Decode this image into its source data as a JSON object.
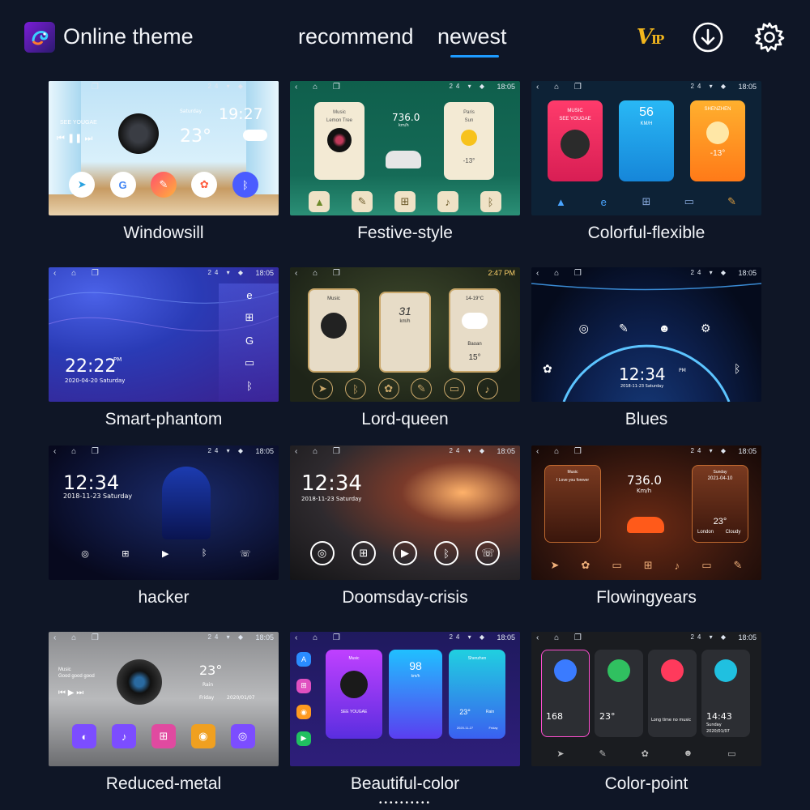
{
  "header": {
    "app_title": "Online theme",
    "tabs": [
      {
        "label": "recommend",
        "selected": false
      },
      {
        "label": "newest",
        "selected": true
      }
    ],
    "vip_label": "V",
    "vip_suffix": "IP",
    "accent_color": "#1e9bff"
  },
  "status_bar": {
    "time": "18:05",
    "nav": "‹ ⌂ ❐",
    "signal": "24 ▾ ◆"
  },
  "themes": [
    {
      "name": "Windowsill",
      "clock": "19:27",
      "date": "Saturday",
      "temp": "23°",
      "music": "SEE YOUGAE"
    },
    {
      "name": "Festive-style",
      "music": "Music",
      "song": "Lemon Tree",
      "speed": "736.0",
      "unit": "km/h",
      "city": "Paris",
      "weather": "Sun",
      "temp": "-13°"
    },
    {
      "name": "Colorful-flexible",
      "music": "MUSIC",
      "artist": "SEE YOUGAE",
      "speed": "56",
      "unit": "KM/H",
      "city": "SHENZHEN",
      "temp": "-13°",
      "apps": [
        "map",
        "explorer",
        "apps",
        "radio",
        "theme"
      ]
    },
    {
      "name": "Smart-phantom",
      "clock": "22:22",
      "ampm": "PM",
      "date": "2020-04-20 Saturday",
      "apps": [
        "explorer",
        "apps",
        "google",
        "radio",
        "bt"
      ]
    },
    {
      "name": "Lord-queen",
      "music": "Music",
      "speed": "31",
      "unit": "km/h",
      "weather": "14-19°C",
      "city": "Baoan",
      "temp": "15°",
      "clock": "2:47 PM"
    },
    {
      "name": "Blues",
      "clock": "12:34",
      "ampm": "PM",
      "date": "2018-11-23 Saturday",
      "apps": [
        "explorer",
        "theme",
        "easteared",
        "setting"
      ]
    },
    {
      "name": "hacker",
      "clock": "12:34",
      "date": "2018-11-23 Saturday",
      "apps": [
        "Kdeis",
        "App",
        "Voice",
        "Bluetooth",
        "Telephone"
      ]
    },
    {
      "name": "Doomsday-crisis",
      "clock": "12:34",
      "date": "2018-11-23 Saturday",
      "apps": [
        "Kdeis",
        "App",
        "Voice",
        "Bluetooth",
        "Telephone"
      ]
    },
    {
      "name": "Flowingyears",
      "music": "Music",
      "song": "I Love you forever",
      "speed": "736.0",
      "unit": "Km/h",
      "date": "2021-04-10",
      "day": "Sunday",
      "temp": "23°",
      "city": "London",
      "weather": "Cloudy"
    },
    {
      "name": "Reduced-metal",
      "music": "Music",
      "song": "Good good good",
      "temp": "23°",
      "weather": "Rain",
      "day": "Friday",
      "date": "2020/01/07",
      "apps": [
        "Theme",
        "Music",
        "App",
        "Voice",
        "Dvr"
      ]
    },
    {
      "name": "Beautiful-color",
      "music": "Music",
      "speed": "98",
      "unit": "km/h",
      "city": "Shenzhen",
      "temp": "23°",
      "weather": "Rain",
      "artist": "SEE YOUGAE",
      "date": "2020-11-27",
      "day": "Friday"
    },
    {
      "name": "Color-point",
      "nav": "168",
      "temp": "23°",
      "clock": "14:43",
      "day": "Sunday",
      "date": "2020/01/07",
      "song": "Long time no music"
    }
  ],
  "pager": "••••••••••"
}
